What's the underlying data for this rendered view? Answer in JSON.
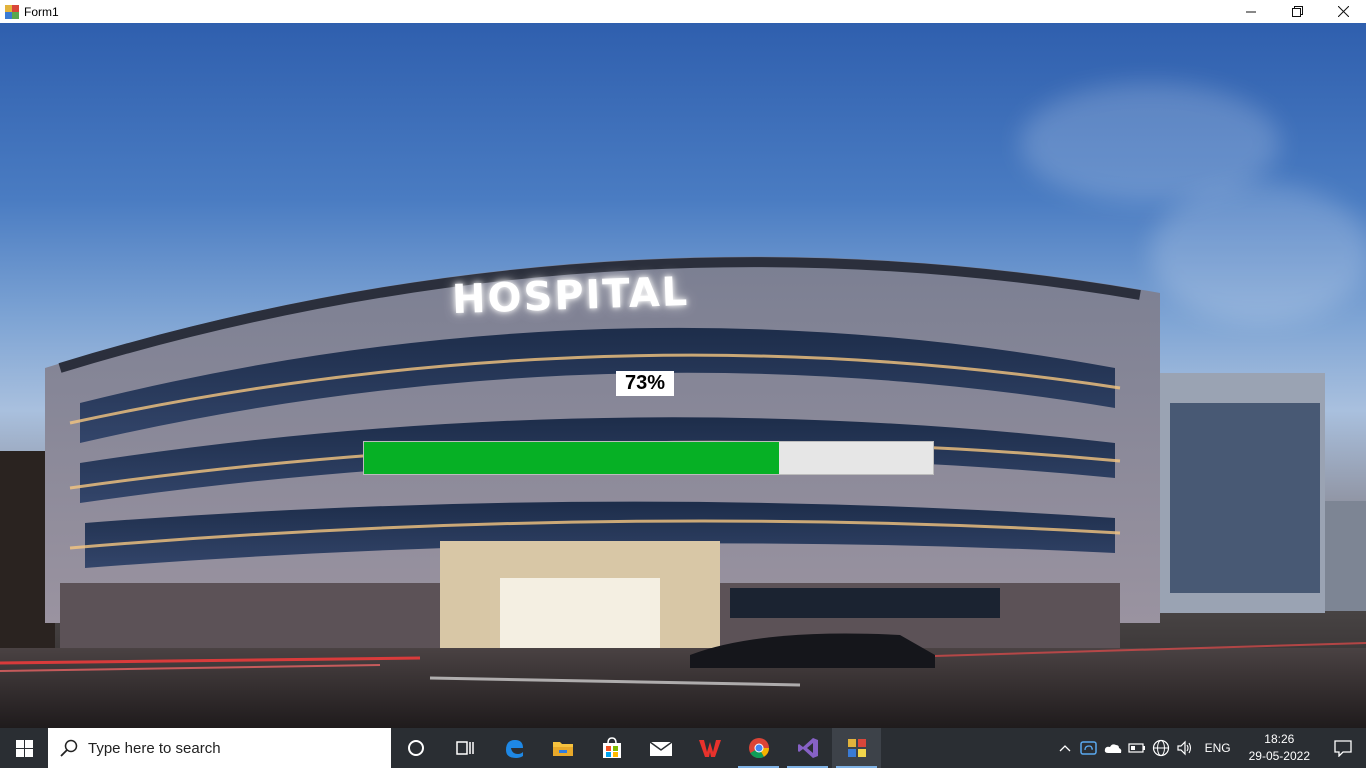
{
  "window": {
    "title": "Form1",
    "minimize_glyph": "—",
    "restore_glyph": "❐",
    "close_glyph": "✕"
  },
  "scene": {
    "sign_text": "HOSPITAL"
  },
  "progress": {
    "label": "73%",
    "value": 0.73,
    "fill_color": "#06b025",
    "track_color": "#e6e6e6"
  },
  "taskbar": {
    "search_placeholder": "Type here to search",
    "apps": [
      "cortana-icon",
      "task-view-icon",
      "edge-icon",
      "file-explorer-icon",
      "store-icon",
      "mail-icon",
      "wps-office-icon",
      "chrome-icon",
      "visual-studio-icon",
      "form-app-icon"
    ],
    "tray": {
      "language": "ENG",
      "time": "18:26",
      "date": "29-05-2022"
    }
  }
}
